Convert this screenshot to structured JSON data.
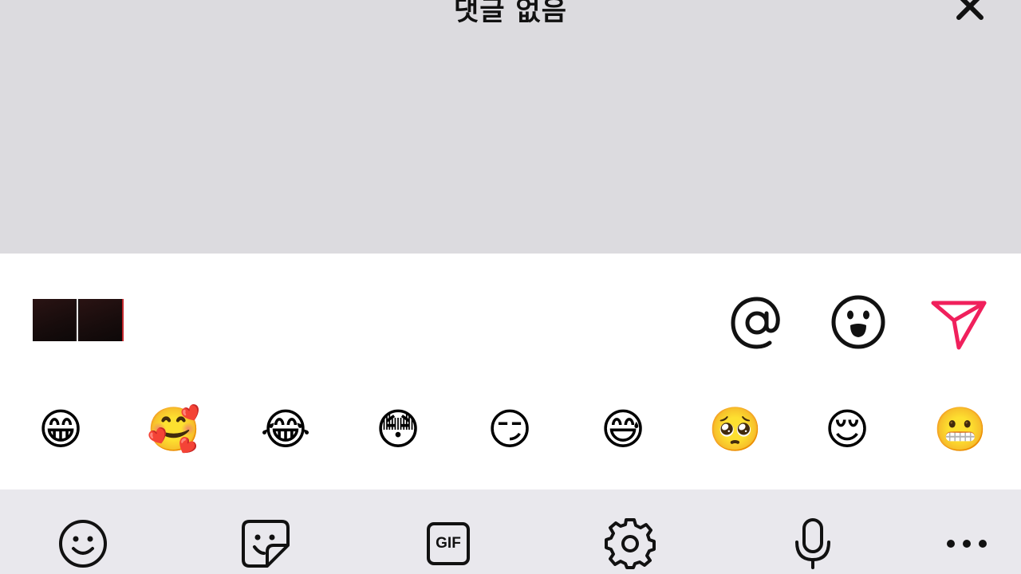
{
  "header": {
    "title": "댓글 없음"
  },
  "composer": {
    "attachment": "video-thumbnail",
    "icons": [
      "at-icon",
      "emoji-face-icon",
      "send-icon"
    ],
    "send_color": "#f0205c"
  },
  "emoji_suggestions": [
    "😁",
    "🥰",
    "😂",
    "😳",
    "😏",
    "😅",
    "🥺",
    "😌",
    "😬"
  ],
  "toolbar": {
    "gif_label": "GIF",
    "items": [
      "smiley-icon",
      "sticker-icon",
      "gif-icon",
      "settings-gear-icon",
      "microphone-icon",
      "more-icon"
    ]
  }
}
